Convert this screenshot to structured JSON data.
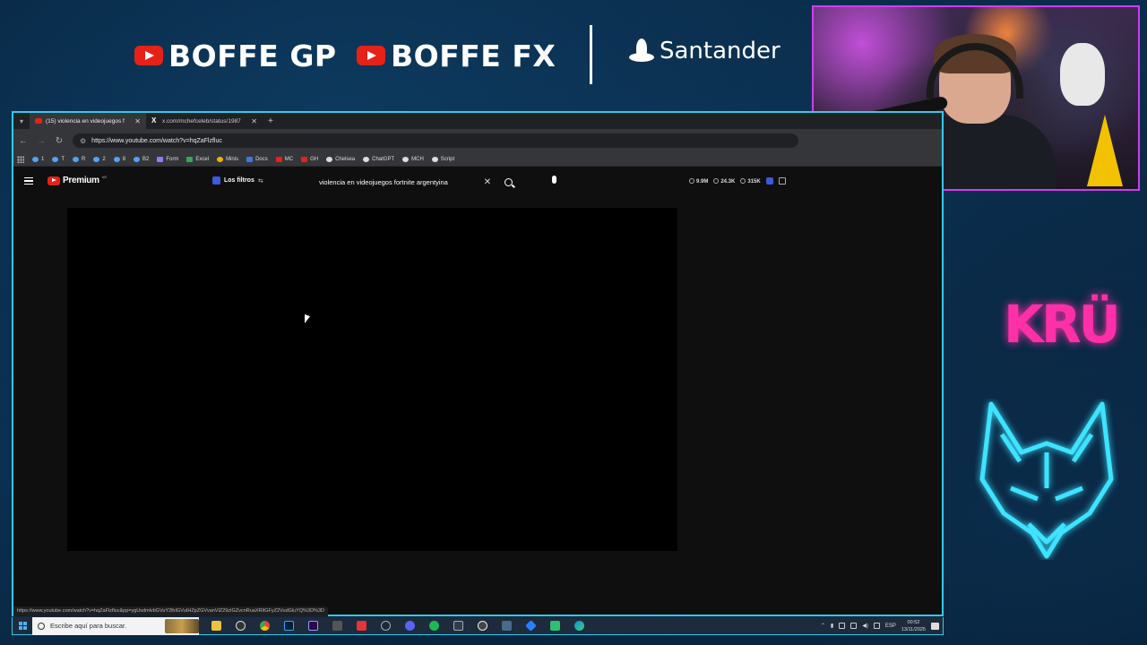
{
  "overlay": {
    "brand1": "BOFFE GP",
    "brand2": "BOFFE FX",
    "sponsor": "Santander",
    "right_logo": "KRÜ"
  },
  "browser": {
    "tabs": [
      {
        "label": "(15) violencia en videojuegos f",
        "active": true,
        "icon": "youtube-icon"
      },
      {
        "label": "x.com/mchefceleb/status/1987",
        "active": false,
        "icon": "x-icon"
      }
    ],
    "url": "https://www.youtube.com/watch?v=hqZaFlzfluc",
    "bookmarks": [
      "1",
      "T",
      "R",
      "2",
      "8",
      "B2",
      "Form",
      "Excel",
      "Minis",
      "Docs",
      "MC",
      "GH",
      "Chelsea",
      "ChatGPT",
      "MCH",
      "Script"
    ],
    "status_url": "https://www.youtube.com/watch?v=hqZaFlzfluc&pp=ygUsdmlvbGVuY2lhIGVuIHZpZGVvanVlZ29zIGZvcnRuaXRlIGFyZ2VudGluYQ%3D%3D"
  },
  "youtube": {
    "logo_text": "Premium",
    "logo_sup": "AR",
    "filters_label": "Los filtros",
    "search_query": "violencia en videojuegos fortnite argentyina",
    "stats": [
      "9.9M",
      "24.3K",
      "315K"
    ]
  },
  "taskbar": {
    "search_placeholder": "Escribe aquí para buscar.",
    "lang": "ESP",
    "time": "00:52",
    "date": "13/11/2025"
  },
  "colors": {
    "accent_border": "#35c9e8",
    "cam_border": "#d23cf0",
    "youtube_red": "#e62117",
    "kru_pink": "#ff2fa8"
  }
}
